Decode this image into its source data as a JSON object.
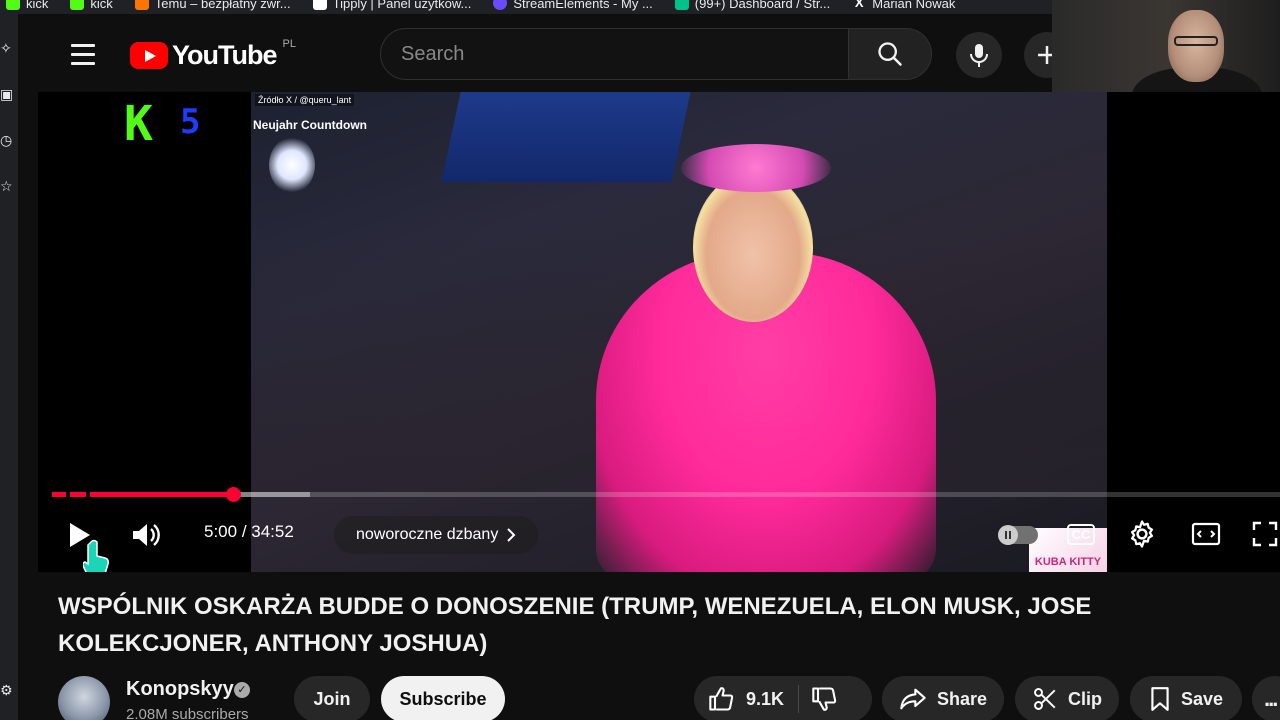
{
  "bookmarks": [
    {
      "label": "kick",
      "color": "#53fc18"
    },
    {
      "label": "kick",
      "color": "#53fc18"
    },
    {
      "label": "Temu – bezpłatny zwr...",
      "color": "#fb7701"
    },
    {
      "label": "Tipply | Panel użytkow...",
      "color": "#ffffff"
    },
    {
      "label": "StreamElements - My ...",
      "color": "#6b4bff"
    },
    {
      "label": "(99+) Dashboard / Str...",
      "color": "#00c389"
    },
    {
      "label": "Marian Nowak",
      "color": "#ffffff"
    }
  ],
  "masthead": {
    "logo_text": "YouTube",
    "region": "PL",
    "search_placeholder": "Search"
  },
  "player": {
    "overlay_source": "Źródło X / @queru_lant",
    "overlay_title": "Neujahr Countdown",
    "overlay_badge": "KUBA KITTY",
    "kick_logo": "K",
    "kick_number": "5",
    "time_current": "5:00",
    "time_separator": " / ",
    "time_total": "34:52",
    "chapter_title": "noworoczne dzbany",
    "progress_played_fraction": 0.147,
    "progress_buffered_fraction": 0.21,
    "cc_label": "CC"
  },
  "video": {
    "title": "WSPÓLNIK OSKARŻA BUDDE O DONOSZENIE (TRUMP, WENEZUELA, ELON MUSK, JOSE KOLEKCJONER, ANTHONY JOSHUA)",
    "channel_name": "Konopskyy",
    "subscribers": "2.08M subscribers",
    "join_label": "Join",
    "subscribe_label": "Subscribe",
    "like_count": "9.1K",
    "share_label": "Share",
    "clip_label": "Clip",
    "save_label": "Save",
    "more_label": "..."
  },
  "colors": {
    "accent_red": "#ff0033",
    "background": "#0f0f0f",
    "pill_bg": "#272727"
  }
}
